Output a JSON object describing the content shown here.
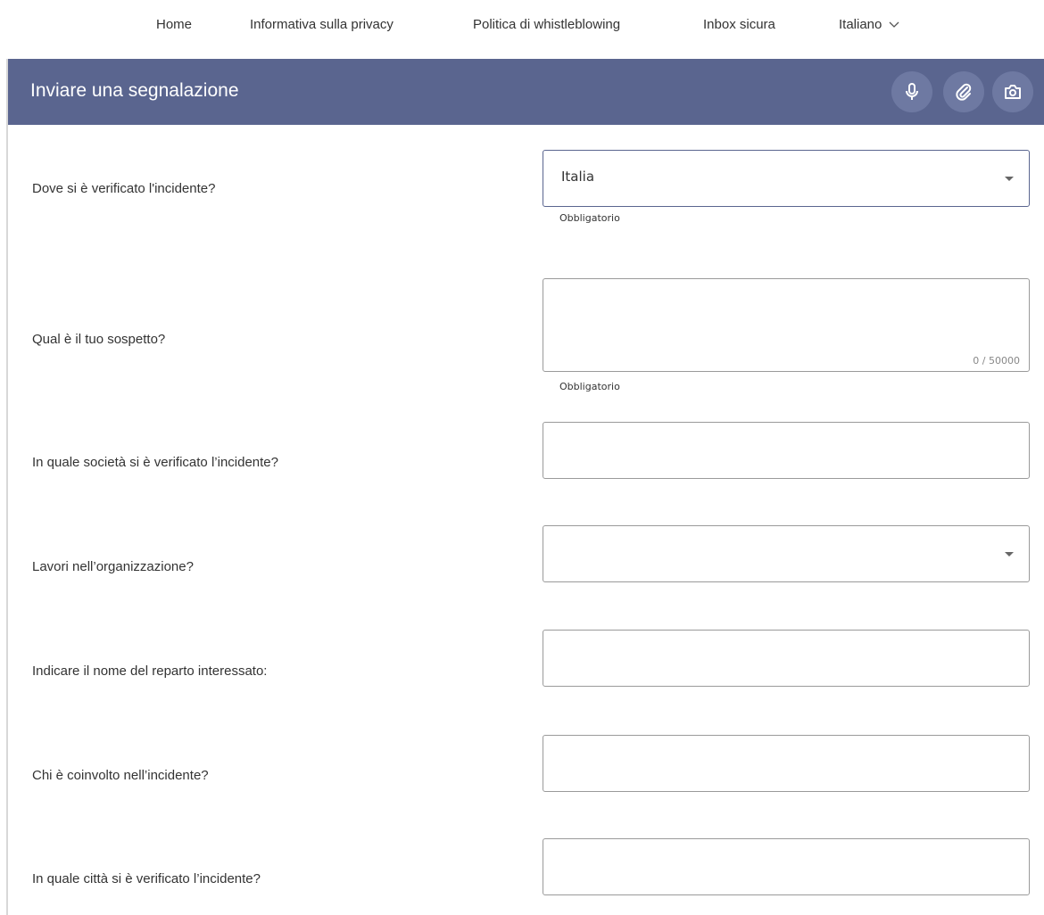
{
  "nav": {
    "items": [
      "Home",
      "Informativa sulla privacy",
      "Politica di whistleblowing",
      "Inbox sicura"
    ],
    "language": "Italiano"
  },
  "header": {
    "title": "Inviare una segnalazione",
    "icons": [
      "microphone-icon",
      "paperclip-icon",
      "camera-icon"
    ]
  },
  "form": {
    "q1": {
      "label": "Dove si è verificato l'incidente?",
      "value": "Italia",
      "hint": "Obbligatorio"
    },
    "q2": {
      "label": "Qual è il tuo sospetto?",
      "value": "",
      "counter": "0 / 50000",
      "hint": "Obbligatorio"
    },
    "q3": {
      "label": "In quale società si è verificato l’incidente?",
      "value": ""
    },
    "q4": {
      "label": "Lavori nell’organizzazione?",
      "value": ""
    },
    "q5": {
      "label": "Indicare il nome del reparto interessato:",
      "value": ""
    },
    "q6": {
      "label": "Chi è coinvolto nell’incidente?",
      "value": ""
    },
    "q7": {
      "label": "In quale città si è verificato l’incidente?",
      "value": ""
    }
  },
  "colors": {
    "header_bg": "#5a658f",
    "header_button_bg": "#6e79a2"
  }
}
